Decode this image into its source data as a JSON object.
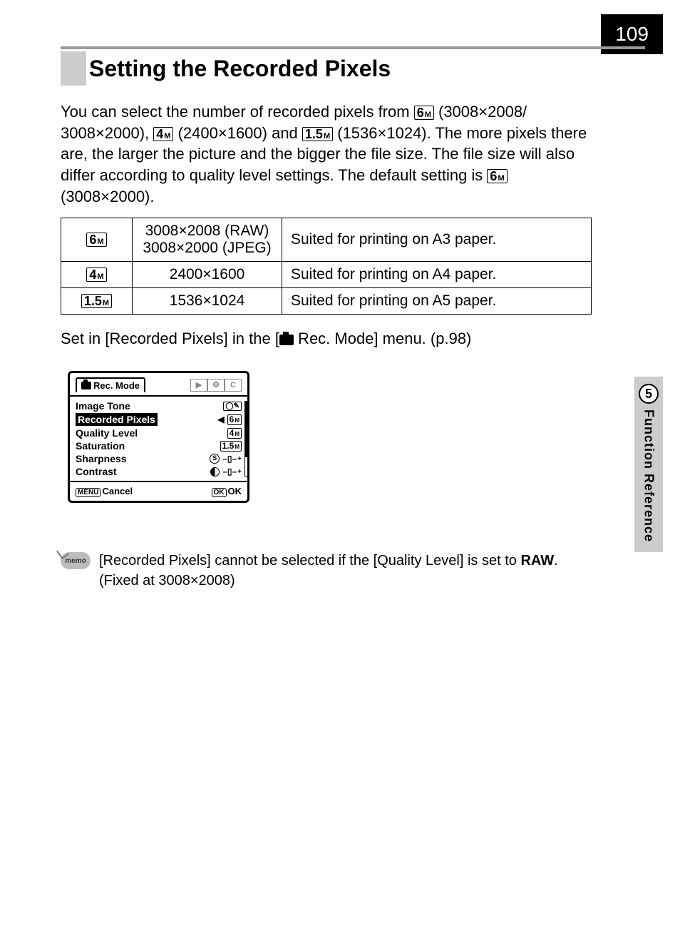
{
  "page_number": "109",
  "section_title": "Setting the Recorded Pixels",
  "intro_parts": {
    "t1": "You can select the number of recorded pixels from ",
    "t2": " (3008×2008/ 3008×2000), ",
    "t3": " (2400×1600) and ",
    "t4": " (1536×1024). The more pixels there are, the larger the picture and the bigger the file size. The file size will also differ according to quality level settings. The default setting is ",
    "t5": " (3008×2000)."
  },
  "badges": {
    "b6": "6",
    "b4": "4",
    "b15": "1.5",
    "suffix": "M"
  },
  "table_rows": [
    {
      "badge": "6",
      "res_line1": "3008×2008 (RAW)",
      "res_line2": "3008×2000 (JPEG)",
      "desc": "Suited for printing on A3 paper."
    },
    {
      "badge": "4",
      "res_line1": "2400×1600",
      "res_line2": "",
      "desc": "Suited for printing on A4 paper."
    },
    {
      "badge": "1.5",
      "res_line1": "1536×1024",
      "res_line2": "",
      "desc": "Suited for printing on A5 paper."
    }
  ],
  "set_in": {
    "t1": "Set in [Recorded Pixels] in the [",
    "t2": " Rec. Mode] menu. (p.98)"
  },
  "menu": {
    "tab_label": "Rec. Mode",
    "rows": {
      "image_tone": "Image Tone",
      "recorded_pixels": "Recorded Pixels",
      "quality_level": "Quality Level",
      "saturation": "Saturation",
      "sharpness": "Sharpness",
      "contrast": "Contrast"
    },
    "footer": {
      "menu": "MENU",
      "cancel": "Cancel",
      "ok_btn": "OK",
      "ok": "OK"
    }
  },
  "memo": {
    "label": "memo",
    "t1": "[Recorded Pixels] cannot be selected if the [Quality Level] is set to ",
    "raw": "RAW",
    "t2": ". (Fixed at 3008×2008)"
  },
  "side": {
    "number": "5",
    "label": "Function Reference"
  }
}
